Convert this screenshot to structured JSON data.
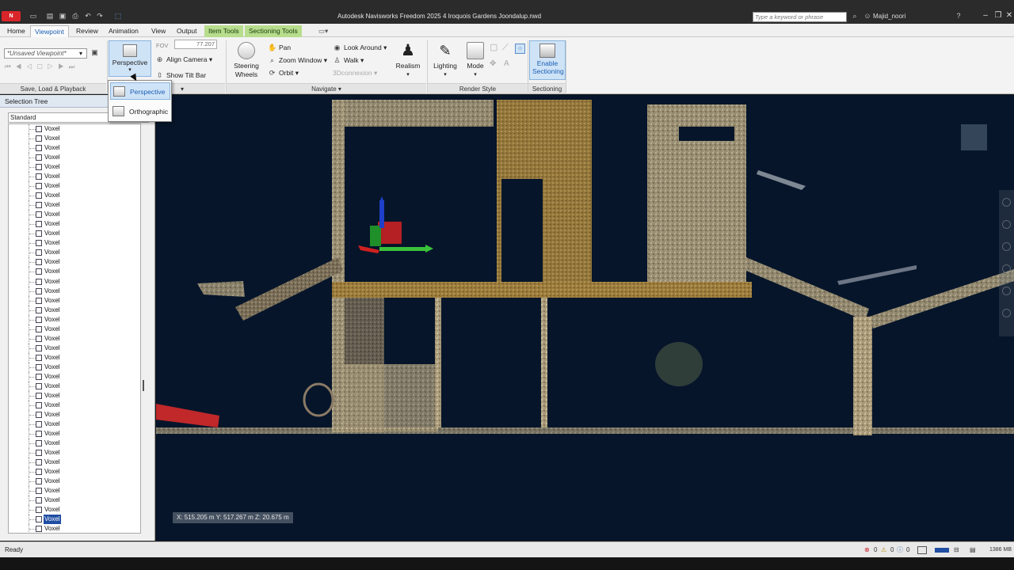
{
  "titlebar": {
    "logo": "N FREE",
    "title": "Autodesk Navisworks Freedom 2025    4 Iroquois Gardens Joondalup.nwd",
    "search_placeholder": "Type a keyword or phrase",
    "user": "Majid_noori"
  },
  "tabs": [
    {
      "label": "Home"
    },
    {
      "label": "Viewpoint"
    },
    {
      "label": "Review"
    },
    {
      "label": "Animation"
    },
    {
      "label": "View"
    },
    {
      "label": "Output"
    },
    {
      "label": "Item Tools"
    },
    {
      "label": "Sectioning Tools"
    }
  ],
  "ribbon": {
    "viewpoint_select": "*Unsaved Viewpoint*",
    "fov_label": "FOV",
    "fov_value": "77.207",
    "perspective": "Perspective",
    "align_camera": "Align Camera",
    "show_tilt_bar": "Show Tilt Bar",
    "steering_wheels": "Steering Wheels",
    "pan": "Pan",
    "zoom_window": "Zoom Window",
    "orbit": "Orbit",
    "look_around": "Look Around",
    "walk": "Walk",
    "connexion": "3Dconnexion",
    "realism": "Realism",
    "lighting": "Lighting",
    "mode": "Mode",
    "enable_sectioning": "Enable Sectioning",
    "groups": {
      "save_load": "Save, Load & Playback",
      "navigate": "Navigate",
      "render_style": "Render Style",
      "sectioning": "Sectioning"
    }
  },
  "dropdown": {
    "items": [
      {
        "label": "Perspective"
      },
      {
        "label": "Orthographic"
      }
    ]
  },
  "selection_tree": {
    "title": "Selection Tree",
    "mode": "Standard",
    "item_label": "Voxel",
    "row_count": 43,
    "selected_index": 41
  },
  "viewport": {
    "coordinates": "X: 515.205 m   Y: 517.267 m   Z: 20.675 m"
  },
  "statusbar": {
    "status": "Ready",
    "counts": [
      "0",
      "0",
      "0"
    ],
    "memory": "1386 MB"
  }
}
